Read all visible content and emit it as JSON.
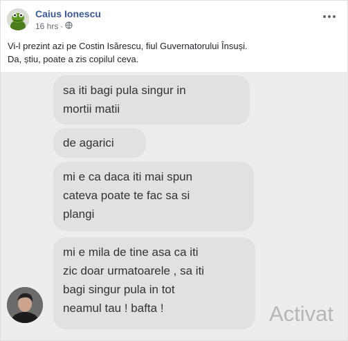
{
  "post": {
    "author": "Caius Ionescu",
    "time": "16 hrs",
    "separator": "·",
    "caption_line1": "Vi-l prezint azi pe Costin Isărescu, fiul Guvernatorului Însuși.",
    "caption_line2": "Da, știu, poate a zis copilul ceva."
  },
  "screenshot": {
    "messages": [
      {
        "lines": [
          "sa iti bagi pula singur in",
          "mortii matii"
        ]
      },
      {
        "lines": [
          "de agarici"
        ]
      },
      {
        "lines": [
          "mi e ca daca iti mai spun",
          "cateva poate te fac sa si",
          "plangi"
        ]
      },
      {
        "lines": [
          "mi e mila de tine asa ca iti",
          "zic doar urmatoarele , sa iti",
          "bagi singur pula in tot",
          "neamul tau ! bafta !"
        ]
      }
    ],
    "watermark": "Activat"
  },
  "icons": {
    "more": "more-options-icon",
    "globe": "globe-icon"
  }
}
